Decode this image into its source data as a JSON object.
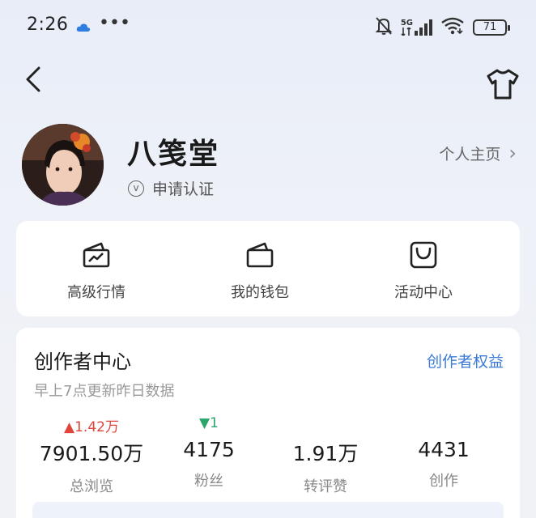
{
  "status_bar": {
    "time": "2:26",
    "dots": "•••",
    "network": "5G",
    "battery": "71"
  },
  "profile": {
    "name": "八笺堂",
    "verify_label": "申请认证",
    "verify_icon_glyph": "v",
    "homepage_label": "个人主页",
    "homepage_chevron": "›"
  },
  "quick_actions": [
    {
      "label": "高级行情",
      "icon": "market-chart-icon"
    },
    {
      "label": "我的钱包",
      "icon": "wallet-icon"
    },
    {
      "label": "活动中心",
      "icon": "shopping-bag-icon"
    }
  ],
  "creator_center": {
    "title": "创作者中心",
    "link": "创作者权益",
    "subtitle": "早上7点更新昨日数据",
    "stats": [
      {
        "delta": "▲1.42万",
        "delta_dir": "up",
        "value": "7901.50万",
        "label": "总浏览"
      },
      {
        "delta": "▼1",
        "delta_dir": "down",
        "value": "4175",
        "label": "粉丝"
      },
      {
        "delta": "",
        "delta_dir": "none",
        "value": "1.91万",
        "label": "转评赞"
      },
      {
        "delta": "",
        "delta_dir": "none",
        "value": "4431",
        "label": "创作"
      }
    ]
  },
  "colors": {
    "accent_link": "#3b7bd6",
    "delta_up": "#e0453c",
    "delta_down": "#2aa56b"
  }
}
